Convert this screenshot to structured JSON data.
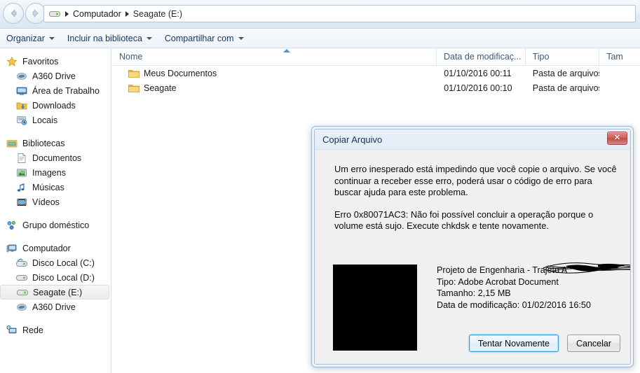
{
  "window": {
    "address": {
      "drive_icon": "hard-drive-icon",
      "crumbs": [
        "Computador",
        "Seagate  (E:)"
      ]
    },
    "nav": {
      "back_icon": "back-arrow-icon",
      "forward_icon": "forward-arrow-icon",
      "history_icon": "chevron-down-icon"
    }
  },
  "toolbar": {
    "items": [
      {
        "label": "Organizar",
        "caret": true
      },
      {
        "label": "Incluir na biblioteca",
        "caret": true
      },
      {
        "label": "Compartilhar com",
        "caret": true
      }
    ]
  },
  "sidebar": {
    "groups": [
      {
        "header": {
          "label": "Favoritos",
          "icon": "star-icon"
        },
        "items": [
          {
            "label": "A360 Drive",
            "icon": "cloud-drive-icon",
            "selected": false
          },
          {
            "label": "Área de Trabalho",
            "icon": "desktop-icon",
            "selected": false
          },
          {
            "label": "Downloads",
            "icon": "downloads-folder-icon",
            "selected": false
          },
          {
            "label": "Locais",
            "icon": "recent-places-icon",
            "selected": false
          }
        ]
      },
      {
        "header": {
          "label": "Bibliotecas",
          "icon": "libraries-icon"
        },
        "items": [
          {
            "label": "Documentos",
            "icon": "documents-library-icon",
            "selected": false
          },
          {
            "label": "Imagens",
            "icon": "pictures-library-icon",
            "selected": false
          },
          {
            "label": "Músicas",
            "icon": "music-library-icon",
            "selected": false
          },
          {
            "label": "Vídeos",
            "icon": "videos-library-icon",
            "selected": false
          }
        ]
      },
      {
        "header": {
          "label": "Grupo doméstico",
          "icon": "homegroup-icon"
        },
        "items": []
      },
      {
        "header": {
          "label": "Computador",
          "icon": "computer-icon"
        },
        "items": [
          {
            "label": "Disco Local (C:)",
            "icon": "system-drive-icon",
            "selected": false
          },
          {
            "label": "Disco Local (D:)",
            "icon": "hard-drive-icon",
            "selected": false
          },
          {
            "label": "Seagate  (E:)",
            "icon": "hard-drive-icon",
            "selected": true
          },
          {
            "label": "A360 Drive",
            "icon": "cloud-drive-icon",
            "selected": false
          }
        ]
      },
      {
        "header": {
          "label": "Rede",
          "icon": "network-icon"
        },
        "items": []
      }
    ]
  },
  "filelist": {
    "columns": [
      {
        "label": "Nome",
        "key": "name"
      },
      {
        "label": "Data de modificaç...",
        "key": "date"
      },
      {
        "label": "Tipo",
        "key": "type"
      },
      {
        "label": "Tam",
        "key": "size"
      }
    ],
    "sort_indicator": "sort-ascending-icon",
    "rows": [
      {
        "name": "Meus Documentos",
        "icon": "folder-icon",
        "date": "01/10/2016 00:11",
        "type": "Pasta de arquivos",
        "size": ""
      },
      {
        "name": "Seagate",
        "icon": "folder-icon",
        "date": "01/10/2016 00:10",
        "type": "Pasta de arquivos",
        "size": ""
      }
    ]
  },
  "dialog": {
    "title": "Copiar Arquivo",
    "close_icon": "close-icon",
    "message_paragraph_1": "Um erro inesperado está impedindo que você copie o arquivo. Se você continuar a receber esse erro, poderá usar o código de erro para buscar ajuda para este problema.",
    "message_paragraph_2": "Erro 0x80071AC3: Não foi possível concluir a operação porque o volume está sujo. Execute chkdsk e tente novamente.",
    "file": {
      "thumbnail": "document-thumbnail",
      "name": "Projeto de Engenharia - Trajeto A",
      "type_line": "Tipo: Adobe Acrobat Document",
      "size_line": "Tamanho: 2,15 MB",
      "modified_line": "Data de modificação: 01/02/2016 16:50",
      "redaction": "scribble-redaction"
    },
    "buttons": {
      "retry": "Tentar Novamente",
      "cancel": "Cancelar"
    }
  },
  "colors": {
    "accent_blue": "#3c9cd6",
    "header_text": "#3c5a79",
    "close_red": "#c24b47",
    "folder_yellow": "#f2c14a",
    "dialog_bg": "#f0f0f0"
  }
}
